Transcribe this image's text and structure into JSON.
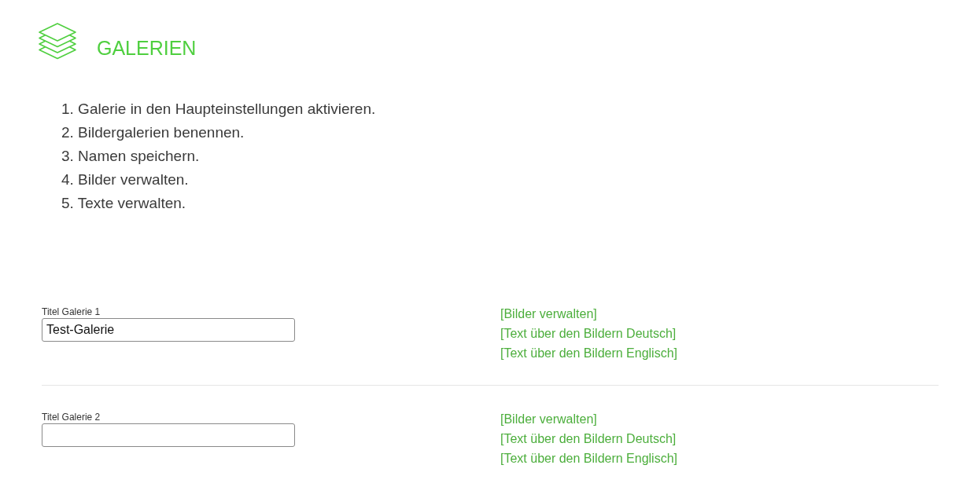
{
  "header": {
    "title": "GALERIEN"
  },
  "steps": [
    "1. Galerie in den Haupteinstellungen aktivieren.",
    "2. Bildergalerien benennen.",
    "3. Namen speichern.",
    "4. Bilder verwalten.",
    "5. Texte verwalten."
  ],
  "galleries": [
    {
      "label": "Titel Galerie 1",
      "value": "Test-Galerie",
      "links": [
        "[Bilder verwalten]",
        "[Text über den Bildern Deutsch]",
        "[Text über den Bildern Englisch]"
      ]
    },
    {
      "label": "Titel Galerie 2",
      "links": [
        "[Bilder verwalten]",
        "[Text über den Bildern Deutsch]",
        "[Text über den Bildern Englisch]"
      ]
    }
  ]
}
